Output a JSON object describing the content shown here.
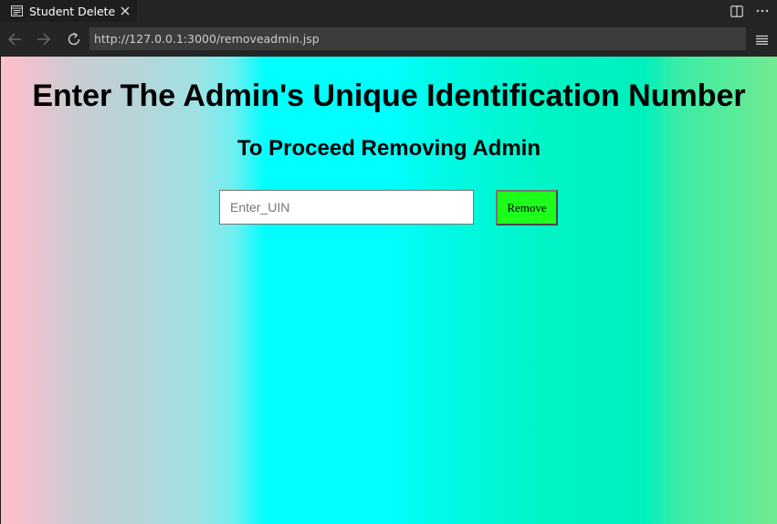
{
  "browser": {
    "tab": {
      "title": "Student Delete",
      "icon": "browser-page-icon",
      "close_icon": "close-icon"
    },
    "actions": [
      "split-editor-icon",
      "more-actions-icon"
    ],
    "nav": {
      "back_icon": "arrow-left-icon",
      "forward_icon": "arrow-right-icon",
      "reload_icon": "reload-icon",
      "url": "http://127.0.0.1:3000/removeadmin.jsp",
      "menu_icon": "hamburger-menu-icon"
    }
  },
  "page": {
    "heading": "Enter The Admin's Unique Identification Number",
    "subheading": "To Proceed Removing Admin",
    "uin_input": {
      "placeholder": "Enter_UIN",
      "value": ""
    },
    "remove_button": "Remove",
    "colors": {
      "button_background": "#1bff1b",
      "gradient_left": "#ffc0cb",
      "gradient_center": "#00ffff",
      "gradient_right": "#72ea90"
    }
  }
}
